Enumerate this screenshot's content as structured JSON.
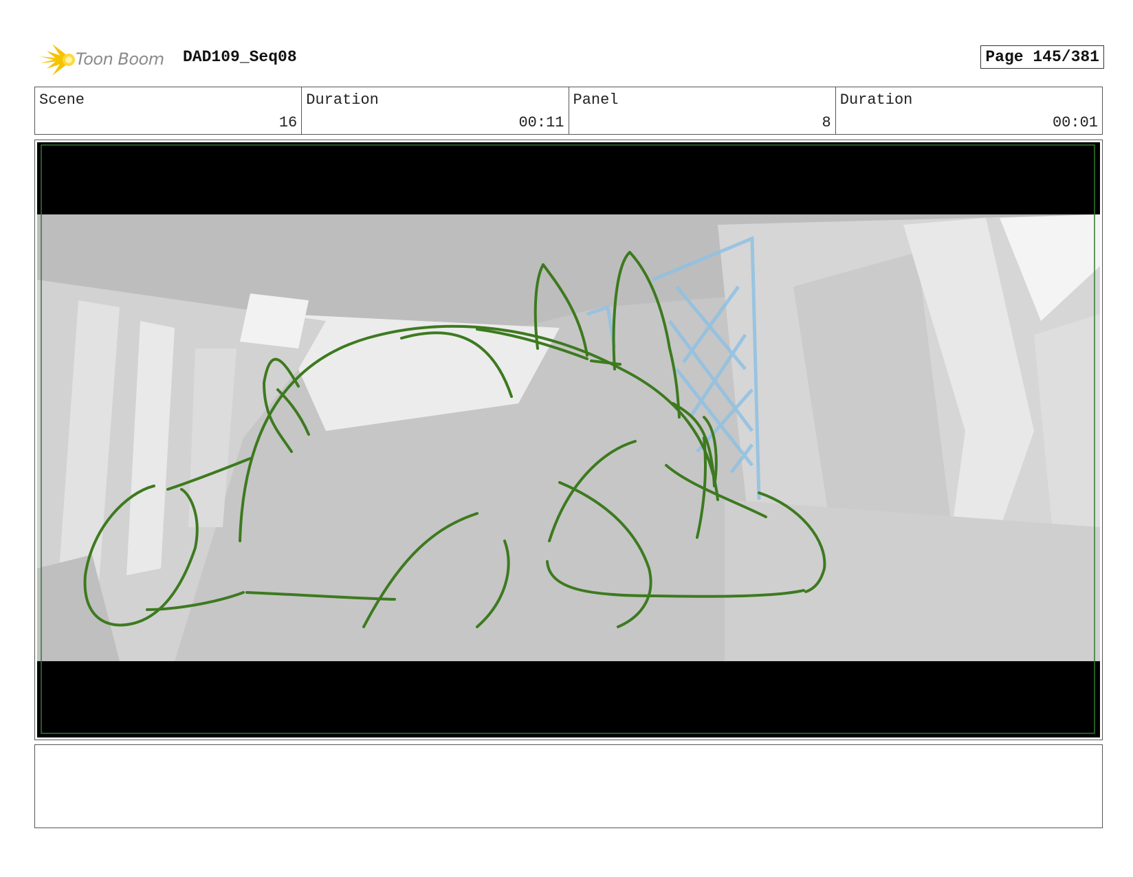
{
  "header": {
    "logo_text": "Toon Boom",
    "title": "DAD109_Seq08",
    "page_label": "Page 145/381"
  },
  "info": {
    "scene_label": "Scene",
    "scene_value": "16",
    "scene_duration_label": "Duration",
    "scene_duration_value": "00:11",
    "panel_label": "Panel",
    "panel_value": "8",
    "panel_duration_label": "Duration",
    "panel_duration_value": "00:01"
  },
  "notes": {
    "text": ""
  },
  "colors": {
    "sketch_line": "#3d7a1f",
    "safe_frame": "#2f7a2f",
    "net_lines": "#8fc1e3",
    "logo_accent": "#f5c400"
  }
}
